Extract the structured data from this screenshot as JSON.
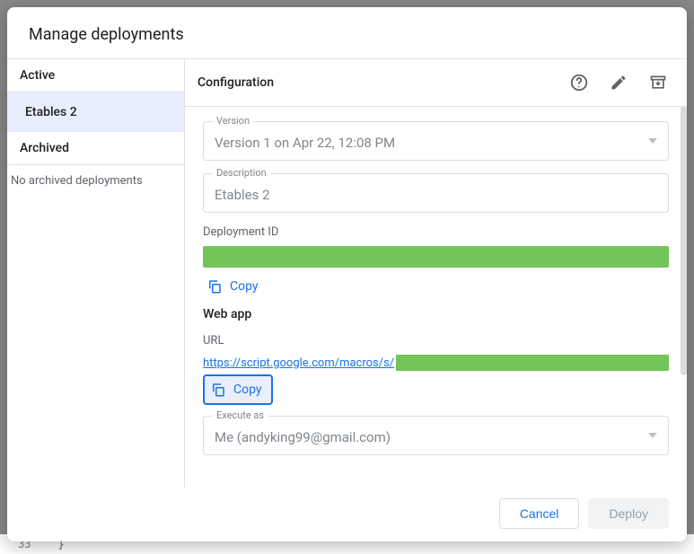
{
  "dialog": {
    "title": "Manage deployments"
  },
  "sidebar": {
    "active_title": "Active",
    "active_items": [
      "Etables 2"
    ],
    "archived_title": "Archived",
    "archived_empty": "No archived deployments"
  },
  "config": {
    "header": "Configuration",
    "version_label": "Version",
    "version_value": "Version 1 on Apr 22, 12:08 PM",
    "description_label": "Description",
    "description_value": "Etables 2",
    "deployment_id_label": "Deployment ID",
    "copy_label": "Copy",
    "webapp_heading": "Web app",
    "url_label": "URL",
    "url_prefix": "https://script.google.com/macros/s/",
    "execute_as_label": "Execute as",
    "execute_as_value": "Me (andyking99@gmail.com)"
  },
  "footer": {
    "cancel": "Cancel",
    "deploy": "Deploy"
  },
  "bg": {
    "line_no": "33",
    "line_code": "}"
  }
}
